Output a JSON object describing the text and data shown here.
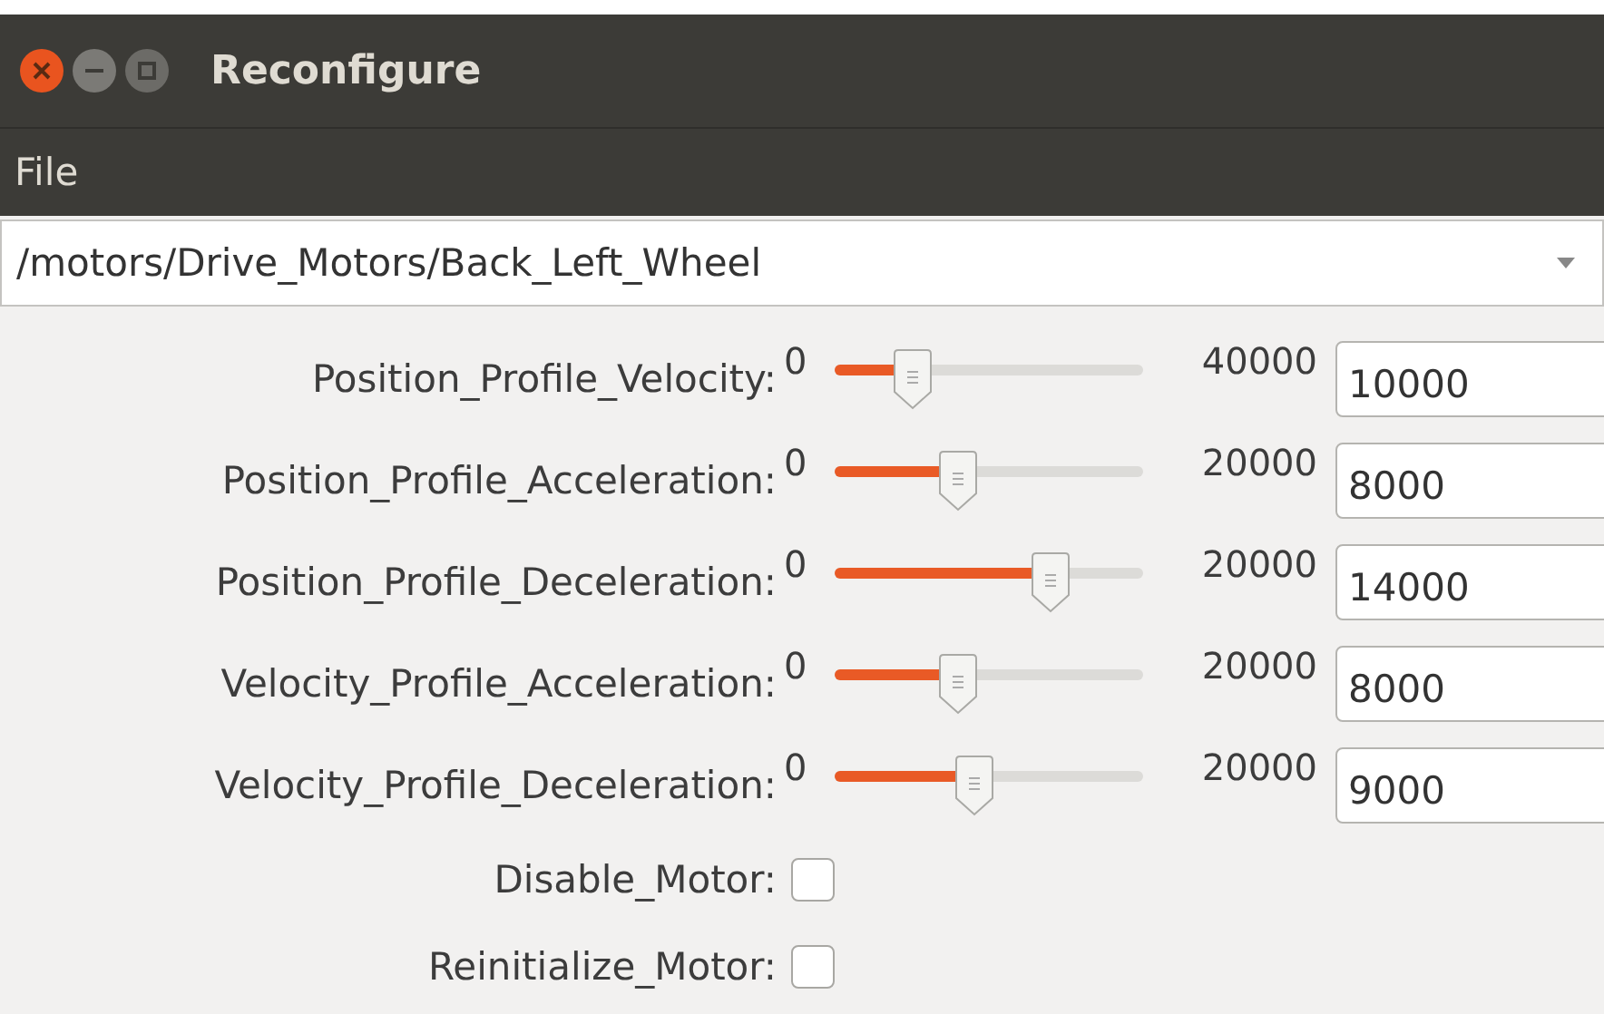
{
  "window": {
    "title": "Reconfigure"
  },
  "menu": [
    "File"
  ],
  "node_selector": {
    "value": "/motors/Drive_Motors/Back_Left_Wheel"
  },
  "params": [
    {
      "kind": "slider",
      "label": "Position_Profile_Velocity:",
      "min": "0",
      "max": "40000",
      "level": 0.25,
      "value": "10000"
    },
    {
      "kind": "slider",
      "label": "Position_Profile_Acceleration:",
      "min": "0",
      "max": "20000",
      "level": 0.4,
      "value": "8000"
    },
    {
      "kind": "slider",
      "label": "Position_Profile_Deceleration:",
      "min": "0",
      "max": "20000",
      "level": 0.7,
      "value": "14000"
    },
    {
      "kind": "slider",
      "label": "Velocity_Profile_Acceleration:",
      "min": "0",
      "max": "20000",
      "level": 0.4,
      "value": "8000"
    },
    {
      "kind": "slider",
      "label": "Velocity_Profile_Deceleration:",
      "min": "0",
      "max": "20000",
      "level": 0.45,
      "value": "9000"
    },
    {
      "kind": "checkbox",
      "label": "Disable_Motor:",
      "checked": false
    },
    {
      "kind": "checkbox",
      "label": "Reinitialize_Motor:",
      "checked": false
    }
  ]
}
